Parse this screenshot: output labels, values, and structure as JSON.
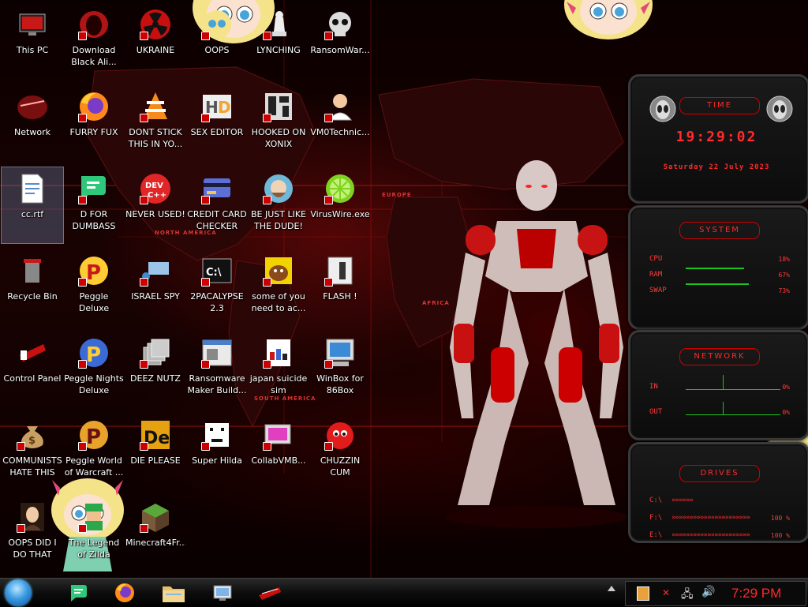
{
  "desktop_icons": [
    {
      "label": "This PC",
      "icon": "computer-icon"
    },
    {
      "label": "Download Black Ali...",
      "icon": "alienware-icon"
    },
    {
      "label": "UKRAINE",
      "icon": "radiation-icon"
    },
    {
      "label": "OOPS",
      "icon": "cartoon-icon"
    },
    {
      "label": "LYNCHING",
      "icon": "chess-icon"
    },
    {
      "label": "RansomWar...",
      "icon": "skull-icon"
    },
    {
      "label": "Network",
      "icon": "network-icon"
    },
    {
      "label": "FURRY FUX",
      "icon": "firefox-icon"
    },
    {
      "label": "DONT STICK THIS IN YO...",
      "icon": "vlc-icon"
    },
    {
      "label": "SEX EDITOR",
      "icon": "hxd-icon"
    },
    {
      "label": "HOOKED ON XONIX",
      "icon": "xonix-icon"
    },
    {
      "label": "VM0Technic...",
      "icon": "doctor-icon"
    },
    {
      "label": "cc.rtf",
      "icon": "document-icon"
    },
    {
      "label": "D FOR DUMBASS",
      "icon": "chat-icon"
    },
    {
      "label": "NEVER USED!",
      "icon": "devcpp-icon"
    },
    {
      "label": "CREDIT CARD CHECKER",
      "icon": "credit-card-icon"
    },
    {
      "label": "BE JUST LIKE THE DUDE!",
      "icon": "dude-icon"
    },
    {
      "label": "VirusWire.exe",
      "icon": "lime-icon"
    },
    {
      "label": "Recycle Bin",
      "icon": "recycle-bin-icon"
    },
    {
      "label": "Peggle Deluxe",
      "icon": "peggle-icon"
    },
    {
      "label": "ISRAEL SPY",
      "icon": "network-spy-icon"
    },
    {
      "label": "2PACALYPSE 2.3",
      "icon": "terminal-icon"
    },
    {
      "label": "some of you need to ac...",
      "icon": "dog-icon"
    },
    {
      "label": "FLASH !",
      "icon": "flash-icon"
    },
    {
      "label": "Control Panel",
      "icon": "control-panel-icon"
    },
    {
      "label": "Peggle Nights Deluxe",
      "icon": "peggle-nights-icon"
    },
    {
      "label": "DEEZ NUTZ",
      "icon": "windows-stack-icon"
    },
    {
      "label": "Ransomware Maker Build...",
      "icon": "window-app-icon"
    },
    {
      "label": "japan suicide sim",
      "icon": "sim-icon"
    },
    {
      "label": "WinBox for 86Box",
      "icon": "winbox-icon"
    },
    {
      "label": "COMMUNISTS HATE THIS G...",
      "icon": "money-bag-icon"
    },
    {
      "label": "Peggle World of Warcraft ...",
      "icon": "peggle-wow-icon"
    },
    {
      "label": "DIE PLEASE",
      "icon": "die-icon"
    },
    {
      "label": "Super Hilda",
      "icon": "pixel-cat-icon"
    },
    {
      "label": "CollabVMB...",
      "icon": "collabvm-icon"
    },
    {
      "label": "CHUZZIN CUM",
      "icon": "chuzzle-icon"
    },
    {
      "label": "OOPS DID I DO THAT",
      "icon": "portrait-icon"
    },
    {
      "label": "The Legend of Zilda",
      "icon": "zelda-icon"
    },
    {
      "label": "Minecraft4Fr...",
      "icon": "minecraft-icon"
    }
  ],
  "map_labels": [
    "NORTH AMERICA",
    "SOUTH AMERICA",
    "EUROPE",
    "AFRICA"
  ],
  "widgets": {
    "time": {
      "title": "TIME",
      "clock": "19:29:02",
      "date": "Saturday 22 July 2023"
    },
    "system": {
      "title": "SYSTEM",
      "rows": [
        {
          "label": "CPU",
          "value": "18%",
          "level": 0.18
        },
        {
          "label": "RAM",
          "value": "67%",
          "level": 0.67
        },
        {
          "label": "SWAP",
          "value": "73%",
          "level": 0.73
        }
      ]
    },
    "network": {
      "title": "NETWORK",
      "rows": [
        {
          "label": "IN",
          "value": "0%"
        },
        {
          "label": "OUT",
          "value": "0%"
        }
      ]
    },
    "drives": {
      "title": "DRIVES",
      "rows": [
        {
          "label": "C:\\",
          "value": ""
        },
        {
          "label": "F:\\",
          "value": "100 %"
        },
        {
          "label": "E:\\",
          "value": "100 %"
        }
      ]
    }
  },
  "taskbar": {
    "start_icon": "windows-orb-icon",
    "pinned": [
      "chat-icon",
      "firefox-icon",
      "folder-icon",
      "control-panel-icon",
      "alienware-icon"
    ],
    "tray_icons": [
      "security-icon",
      "volume-muted-icon",
      "network-tray-icon",
      "speaker-icon"
    ],
    "clock": "7:29 PM"
  },
  "colors": {
    "accent": "#ff2a2a",
    "background": "#0a0000",
    "widget_bg": "#111111"
  }
}
